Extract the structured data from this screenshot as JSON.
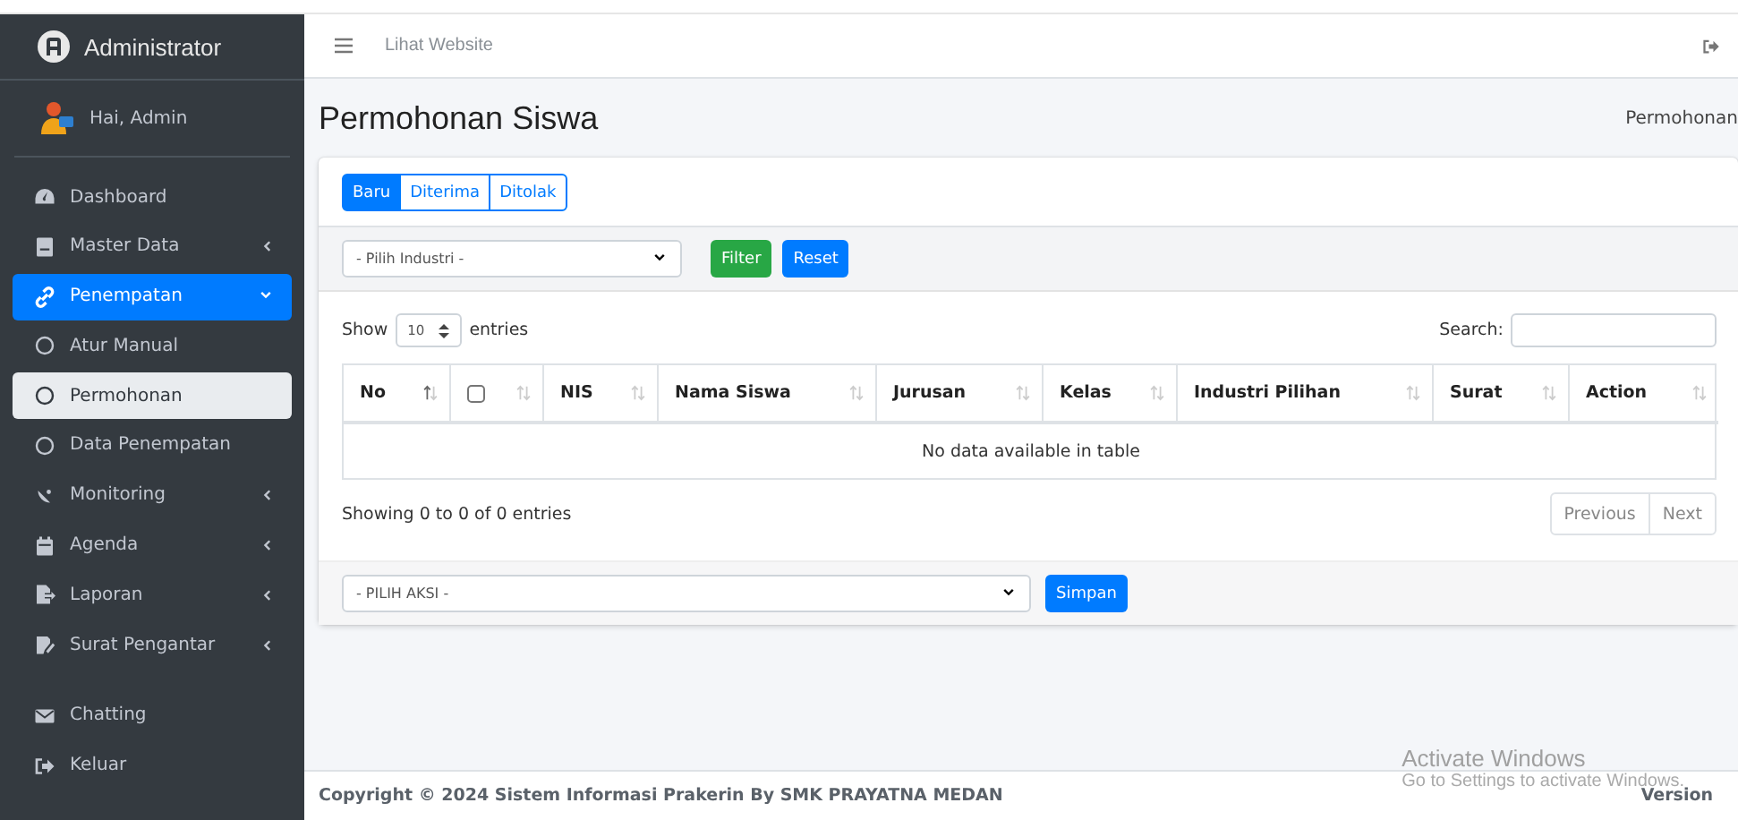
{
  "brand": {
    "title": "Administrator"
  },
  "user": {
    "greeting": "Hai, Admin"
  },
  "sidebar": {
    "items": [
      {
        "label": "Dashboard",
        "expandable": false
      },
      {
        "label": "Master Data",
        "expandable": true,
        "expanded": false
      },
      {
        "label": "Penempatan",
        "expandable": true,
        "expanded": true,
        "selected": true,
        "children": [
          {
            "label": "Atur Manual",
            "selected": false
          },
          {
            "label": "Permohonan",
            "selected": true
          },
          {
            "label": "Data Penempatan",
            "selected": false
          }
        ]
      },
      {
        "label": "Monitoring",
        "expandable": true,
        "expanded": false
      },
      {
        "label": "Agenda",
        "expandable": true,
        "expanded": false
      },
      {
        "label": "Laporan",
        "expandable": true,
        "expanded": false
      },
      {
        "label": "Surat Pengantar",
        "expandable": true,
        "expanded": false
      },
      {
        "label": "Chatting",
        "expandable": false,
        "gap_before": true
      },
      {
        "label": "Keluar",
        "expandable": false
      }
    ]
  },
  "topbar": {
    "link": "Lihat Website"
  },
  "page": {
    "title": "Permohonan Siswa",
    "breadcrumb": "Permohonan"
  },
  "tabs": [
    {
      "label": "Baru",
      "selected": true
    },
    {
      "label": "Diterima",
      "selected": false
    },
    {
      "label": "Ditolak",
      "selected": false
    }
  ],
  "filter": {
    "select": "- Pilih Industri -",
    "buttons": [
      {
        "label": "Filter",
        "kind": "success"
      },
      {
        "label": "Reset",
        "kind": "primary"
      }
    ]
  },
  "table": {
    "length": {
      "prefix": "Show",
      "value": "10",
      "suffix": "entries"
    },
    "search_label": "Search:",
    "columns": [
      {
        "label": "No",
        "kind": "text",
        "sorted": true
      },
      {
        "kind": "checkbox",
        "checked": false,
        "sorted": false
      },
      {
        "label": "NIS",
        "kind": "text",
        "sorted": false
      },
      {
        "label": "Nama Siswa",
        "kind": "text",
        "sorted": false
      },
      {
        "label": "Jurusan",
        "kind": "text",
        "sorted": false
      },
      {
        "label": "Kelas",
        "kind": "text",
        "sorted": false
      },
      {
        "label": "Industri Pilihan",
        "kind": "text",
        "sorted": false
      },
      {
        "label": "Surat",
        "kind": "text",
        "sorted": false
      },
      {
        "label": "Action",
        "kind": "text",
        "sorted": false
      }
    ],
    "empty": "No data available in table",
    "info": "Showing 0 to 0 of 0 entries",
    "pagination": [
      {
        "label": "Previous",
        "disabled": true
      },
      {
        "label": "Next",
        "disabled": true
      }
    ]
  },
  "action": {
    "select": "- PILIH AKSI -",
    "button": "Simpan"
  },
  "footer": {
    "copyright": "Copyright © 2024 Sistem Informasi Prakerin By SMK PRAYATNA MEDAN",
    "version": "Version"
  },
  "os_overlay": {
    "title": "Activate Windows",
    "subtitle": "Go to Settings to activate Windows."
  }
}
